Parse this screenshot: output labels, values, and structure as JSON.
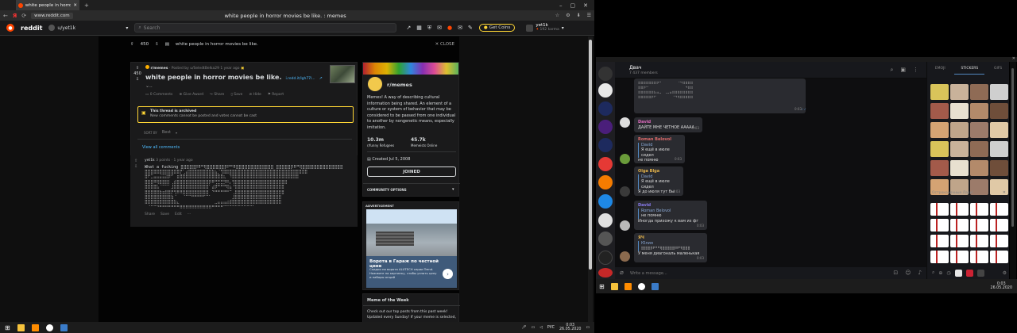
{
  "browser": {
    "tab_title": "white people in horror movies be like. : memes",
    "url": "www.reddit.com",
    "page_title": "white people in horror movies be like. : memes"
  },
  "reddit": {
    "logo_text": "reddit",
    "community": "u/yet1k",
    "search_placeholder": "Search",
    "get_coins": "Get Coins",
    "username": "yet1k",
    "karma": "192 karma",
    "post_bar_score": "450",
    "post_bar_title": "white people in horror movies be like.",
    "close_label": "CLOSE",
    "post": {
      "score": "450",
      "meta_sub": "r/memes",
      "meta_posted": "· Posted by u/SeledtBelka29 1 year ago",
      "title": "white people in horror movies be like.",
      "link": "i.redd.it/lgh77l...",
      "comments": "0 Comments",
      "give_award": "Give Award",
      "share": "Share",
      "save": "Save",
      "hide": "Hide",
      "report": "Report"
    },
    "archived": {
      "title": "This thread is archived",
      "text": "New comments cannot be posted and votes cannot be cast"
    },
    "sort_by": "SORT BY",
    "sort_value": "Best",
    "view_all": "View all comments",
    "comment": {
      "user": "yet1k",
      "meta": "3 points · 1 year ago",
      "first_line": "What a fucking ⣿⣿⣿⣿⣿⡿⠿⠛⢿⣿⣿⣿⣿⣿⣿⡿⠟⠛⠿⣿⣿⣿⣿⣿⣿⣿⣿⣿⣿⣿⣿⣿ ⣿⣿⣿⣿⣿⡿⠿⠛⢿⣿⣿⣿⣿⣿⣿⣿⣿⣿⣿⣿⣿⣿⣿",
      "ascii": [
        "⣿⣿⣿⣿⣿⣿⣿⣿⣿⣿⣿⣿⡟⢁⣴⣿⣿⣿⣿⣿⣿⣿⣿⣷⣦⡈⢻⣿⣿⣿⣿⣿⣿⣿⣿⣿⣿⣿⣿⣿⣿⣿⣿⣿⣿⣿⣿⣿⣿⣿⣿⣿⣿⣿⣿⣿",
        "⣿⠟⣉⣤⣤⣬⣭⣽⡿⠋⠀⣶⣿⣿⣿⣿⣿⣿⣿⣿⣿⣿⣿⣿⣿⣿⣿⣆⠀⠹⣿⣿⣿⣿⣿⣿⣿⣿⣿⣿⣿⣿⣿⣿⣿⣿⣿⣿⣿⣿⣿⣿⣿",
        "⣿⣿⣿⠿⢿⣿⣿⣿⡇⢀⣾⣿⣿⣿⣿⣿⣿⣿⣿⣿⣿⣿⡿⠿⢛⣛⣛⡻⠿⡄⢻⣿⣿⣿⣿⣿⣿⣿⣿⣿⣿⣿⣿⣿⣿⣿⣿⣿⣿",
        "⣿⣿⣿⣿⣧⠈⠉⠉⠁⣸⣿⣿⣿⣿⣿⣿⣿⣿⣿⣿⣿⣿⠁⣴⡿⠛⠛⠛⢿⣦⠘⣿⣿⣿⣿⣿⣿⣿⣿⣿⣿⣿⣿⣿⣿⣿⣿⣿",
        "⣿⣿⣿⣿⣿⣷⣶⣿⣿⡟⢻⠿⠿⣿⣿⣿⣿⣿⣿⣿⣿⣿⠀⠙⠛⠛⠛⠛⠛⠉⢀⣿⣿⣿⣿⣿⣿⣿⣿⣿⣿⣿⣿⣿⣿⣿⣿⣿",
        "⣿⣿⣿⣿⣿⣿⣿⣿⣿⣷⠈⠀⠀⠈⠉⠉⠛⠛⠛⠛⠋⠉⠁⠀⠀⠀⠀⠀⠀⠀⣸⣿⣿⣿⣿⣿⣿⣿⣿⣿⣿⣿⣿⣿⣿⣿⣿",
        "⣿⣿⣿⣿⣿⣿⣿⣿⣿⣿⣷⣄⠀⠀⠀⠀⠀⠀⠀⠀⠀⠀⠀⠀⣀⣤⣤⣤⣴⣾⣿⣿⣿⣿⣿⣿⣿⣿⣿⣿⣿⣿⣿⣿⣿⣿⣿",
        "⠀⠈⠉⠉⠙⠛⠛⠛⠛⠛⠛⠛⠿⠿⠿⠿⠿⠿⠿⠿⠿⠿⠿⠛⠛⠛⠛⠉⠉⠉⠉⠉⠉⠉⠉⠉⠉⠁⠀⠀⠀⠀⠀⠀⠀⠀"
      ],
      "actions": [
        "Share",
        "Save",
        "Edit",
        "···"
      ]
    },
    "sidebar": {
      "name": "r/memes",
      "description": "Memes! A way of describing cultural information being shared. An element of a culture or system of behavior that may be considered to be passed from one individual to another by nongenetic means, especially imitation.",
      "members": "10.3m",
      "members_label": "r/funny Refugees",
      "online": "45.7k",
      "online_label": "Memeists Online",
      "created": "Created Jul 5, 2008",
      "joined": "JOINED",
      "options": "COMMUNITY OPTIONS"
    },
    "ad": {
      "label": "ADVERTISEMENT",
      "title": "Ворота в Гараж по честной цене",
      "text": "Скидки на ворота ALUTECH серии Trend. Нажмите на картинку, чтобы узнать цену и наборы опций"
    },
    "meme_week": {
      "title": "Meme of the Week",
      "text": "Check out our top posts from this past week! Updated every Sunday! If your meme is selected,"
    }
  },
  "taskbar_left": {
    "lang": "РУС",
    "time": "0:03",
    "date": "26.05.2020"
  },
  "telegram": {
    "chat_name": "Двач",
    "members": "7 437 members",
    "input_placeholder": "Write a message...",
    "tabs": [
      "EMOJI",
      "STICKERS",
      "GIFS"
    ],
    "sticker_set_title": "Остроконечные Лаки!",
    "messages": [
      {
        "author": "",
        "text": "",
        "time": "0:03"
      },
      {
        "author": "David",
        "text": "ДАЙТЕ МНЕ ЧЕТНОЕ ААААА",
        "time": "0:03"
      },
      {
        "author": "Roman Belovol",
        "reply_author": "David",
        "reply_text": "Я ещё в июле сидел",
        "text": "не помню",
        "time": "0:03"
      },
      {
        "author": "Olga Blga",
        "reply_author": "David",
        "reply_text": "Я ещё в июле сидел",
        "text": "Я до июля тут бы",
        "time": "0:03"
      },
      {
        "author": "David",
        "reply_author": "Roman Belovol",
        "reply_text": "не помню",
        "text": "Иногда прихожу к вам из фг",
        "time": "0:03"
      },
      {
        "author": "ЯЧ",
        "reply_author": "Юлия",
        "reply_text": "⣿⣿⣿⣿⡿⠟⠛⠛⢿⣿⣿⣿⣿⣿⡿⠿⠛⢿⣿⣿⣿",
        "text": "У меня диагональ маленькая",
        "time": "0:03"
      }
    ],
    "ascii_top": [
      "⣿⣿⣿⣿⣿⣿⣿⡿⠛⠉⠁⠀⠀⠈⠉⠙⠻⣿⣿⣿⣿",
      "⣿⣿⡿⠛⠉⠀⠀⠀⠀⠀⠀⠀⠀⠀⠀⠀⠀⠈⠻⣿⣿",
      "⣿⣿⣿⣿⣿⣷⣦⣤⣀⠀⢀⣀⣤⣶⣾⣿⣿⣿⣿⣿⣿",
      "⣿⣿⣿⣿⣿⡿⠟⠉⠀⠀⠀⠀⠈⠙⠻⢿⣿⣿⣿⣿⣿",
      "⠉⠉⠉⠁⠀⠀⠀⠀⠀⠀⠀⠀⠀⠀⠀⠀⠈⠉⠉⠉⠁",
      "⠀⠀⠀⠀⠀⠀⠀⠀⠀⠀⠀⠀⠀⠀⠀⠀⠀⠀⠀⠀⠀"
    ]
  },
  "taskbar_right": {
    "time": "0:03",
    "date": "26.05.2020"
  },
  "colors": {
    "reddit_orange": "#ff4500",
    "reddit_blue": "#4fbcff",
    "archive_yellow": "#ffd635",
    "telegram_accent": "#5288c1"
  }
}
